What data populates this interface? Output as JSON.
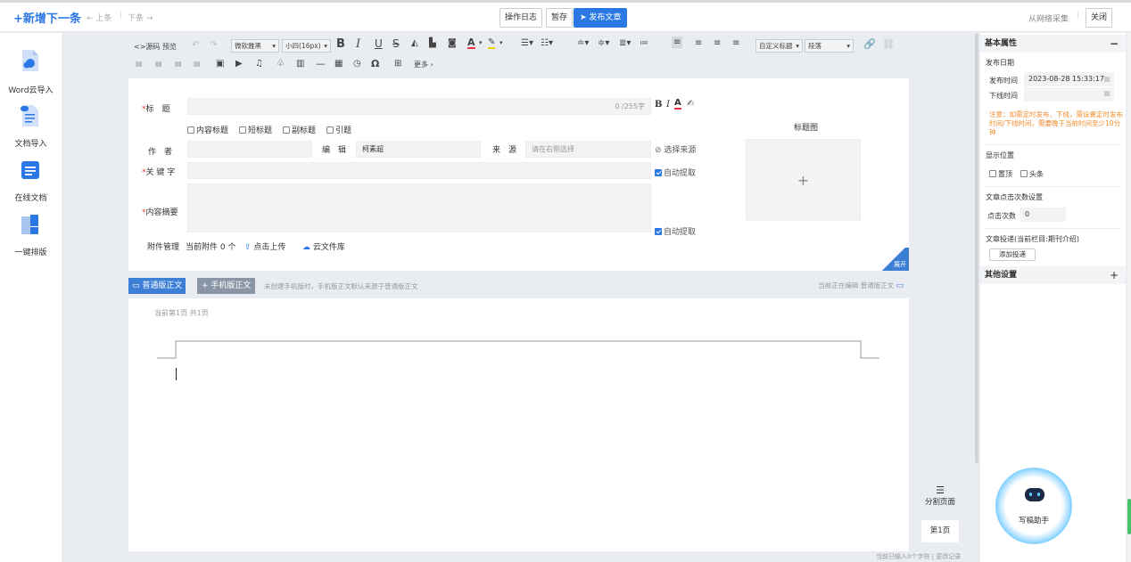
{
  "header": {
    "new_next": "+新增下一条",
    "prev": "← 上条",
    "next": "下条 →",
    "op_log": "操作日志",
    "save_draft": "暂存",
    "publish": "发布文章",
    "net_collect": "从网络采集",
    "close": "关闭"
  },
  "left_sidebar": {
    "items": [
      {
        "label": "Word云导入",
        "icon": "word-cloud-icon"
      },
      {
        "label": "文档导入",
        "icon": "doc-import-icon"
      },
      {
        "label": "在线文档",
        "icon": "online-doc-icon"
      },
      {
        "label": "一键排版",
        "icon": "one-click-layout-icon"
      }
    ]
  },
  "toolbar": {
    "source": "<>源码",
    "preview": "预览",
    "font_family": "微软雅黑",
    "font_size": "小四(16px)",
    "custom_title": "自定义标题",
    "paragraph": "段落",
    "more": "更多"
  },
  "form": {
    "title_label": "标　题",
    "title_counter": "0 /255字",
    "title_options": [
      "内容标题",
      "短标题",
      "副标题",
      "引题"
    ],
    "author_label": "作　者",
    "editor_label": "编　辑",
    "editor_value": "柯素超",
    "source_label": "来　源",
    "source_placeholder": "请在右侧选择",
    "choose_source": "选择来源",
    "keywords_label": "关 键 字",
    "auto_extract": "自动提取",
    "summary_label": "内容摘要",
    "auto_extract2": "自动提取",
    "attach_label": "附件管理",
    "attach_count": "当前附件 0 个",
    "upload": "点击上传",
    "cloud_lib": "云文件库",
    "title_image_label": "标题图",
    "plus": "+",
    "fold": "展开"
  },
  "tabs": {
    "normal": "普通版正文",
    "mobile": "+ 手机版正文",
    "hint": "未创建手机版时，手机版正文默认来源于普通版正文",
    "editing": "当前正在编辑  普通版正文"
  },
  "editor": {
    "page_info": "当前第1页  共1页",
    "split_page": "分割页面",
    "page_badge": "第1页",
    "footer": "当前已输入0个字符 | 更改记录"
  },
  "right_panel": {
    "basic_props": "基本属性",
    "collapse": "−",
    "publish_date": "发布日期",
    "publish_time_label": "发布时间",
    "publish_time_value": "2023-08-28 15:33:17",
    "offline_time_label": "下线时间",
    "note": "注意：如需定时发布、下线，需设置定时发布时间/下线时间，需要晚于当前时间至少10分钟",
    "display_pos": "显示位置",
    "pos_options": [
      "置顶",
      "头条"
    ],
    "click_settings": "文章点击次数设置",
    "click_label": "点击次数",
    "click_value": "0",
    "submit_label": "文章投递(当前栏目:期刊介绍)",
    "add_submit": "添加投递",
    "other_settings": "其他设置",
    "expand": "+",
    "assistant": "写稿助手"
  },
  "colors": {
    "accent": "#2b78e4",
    "tab_active": "#3e7fd6",
    "tab_inactive": "#8a95a5",
    "warning": "#f08c2c",
    "required": "#e4393c"
  }
}
